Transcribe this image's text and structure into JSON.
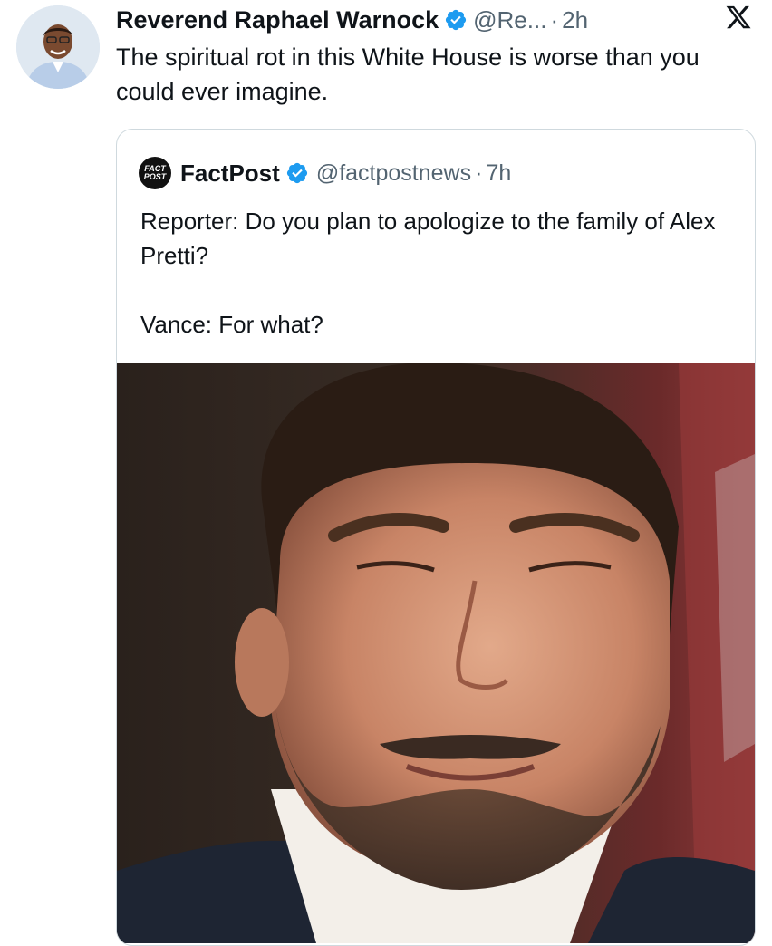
{
  "tweet": {
    "author_name": "Reverend Raphael Warnock",
    "handle": "@Re...",
    "separator": "·",
    "time": "2h",
    "text": "The spiritual rot in this White House is worse than you could ever imagine.",
    "avatar_icon": "profile-photo",
    "platform_icon": "x-logo-icon"
  },
  "quote": {
    "author_name": "FactPost",
    "handle": "@factpostnews",
    "separator": "·",
    "time": "7h",
    "avatar_line1": "FACT",
    "avatar_line2": "POST",
    "text_line1": "Reporter: Do you plan to apologize to the family of Alex Pretti?",
    "text_line2": "Vance: For what?"
  },
  "colors": {
    "verified_blue": "#1d9bf0",
    "secondary_text": "#536471",
    "border": "#cfd9de"
  }
}
